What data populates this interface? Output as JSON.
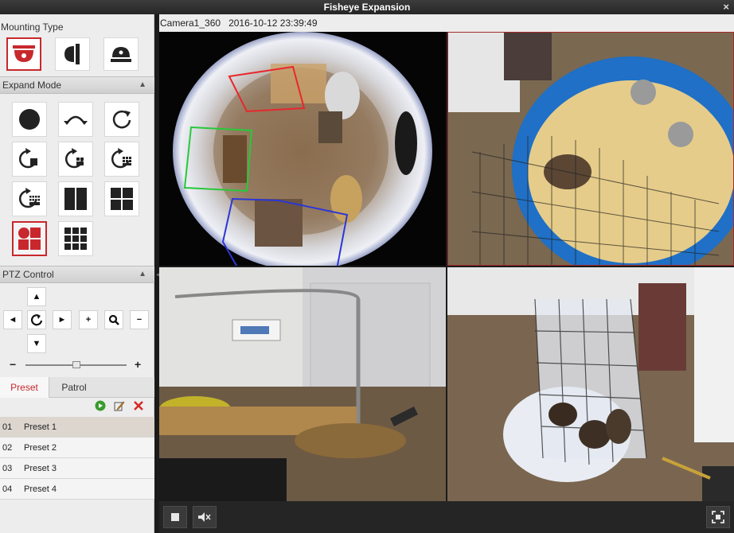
{
  "window": {
    "title": "Fisheye Expansion",
    "close_glyph": "×"
  },
  "sidebar": {
    "mounting_type_label": "Mounting Type",
    "expand_mode_label": "Expand Mode",
    "ptz_control_label": "PTZ Control",
    "tabs": [
      {
        "label": "Preset"
      },
      {
        "label": "Patrol"
      }
    ],
    "zoom_minus": "−",
    "zoom_plus": "+",
    "ptz": {
      "up": "▲",
      "down": "▼",
      "left": "◄",
      "right": "►",
      "zoom_in": "+",
      "zoom_out": "−"
    },
    "presets": [
      {
        "num": "01",
        "name": "Preset 1"
      },
      {
        "num": "02",
        "name": "Preset 2"
      },
      {
        "num": "03",
        "name": "Preset 3"
      },
      {
        "num": "04",
        "name": "Preset 4"
      }
    ]
  },
  "video": {
    "camera_name": "Camera1_360",
    "timestamp": "2016-10-12 23:39:49"
  },
  "colors": {
    "accent_red": "#c8282d",
    "panel_bg": "#ededed",
    "fisheye_red_box": "#e8272d",
    "fisheye_green_box": "#26c93a",
    "fisheye_blue_box": "#2c36d6"
  }
}
